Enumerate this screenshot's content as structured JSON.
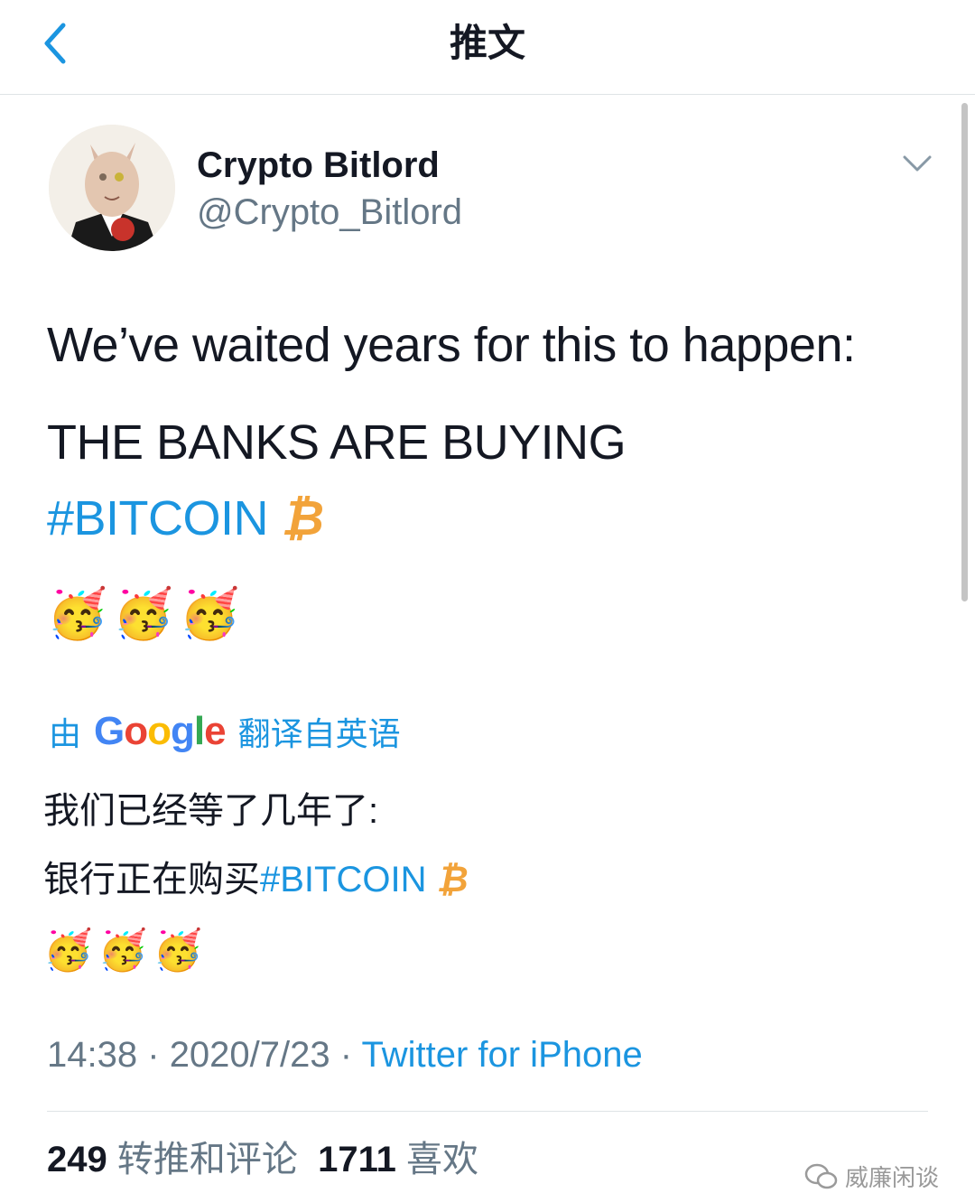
{
  "header": {
    "title": "推文"
  },
  "author": {
    "display_name": "Crypto Bitlord",
    "handle": "@Crypto_Bitlord"
  },
  "tweet": {
    "line1": "We’ve waited years for this to happen:",
    "line2": "THE BANKS ARE BUYING",
    "hashtag": "#BITCOIN",
    "btc_symbol": "₿",
    "emojis": [
      "🥳",
      "🥳",
      "🥳"
    ]
  },
  "translation": {
    "prefix": "由",
    "provider": "Google",
    "suffix": "翻译自英语",
    "line1": "我们已经等了几年了:",
    "line2_text": "银行正在购买",
    "line2_hashtag": "#BITCOIN",
    "btc_symbol": "₿",
    "emojis": [
      "🥳",
      "🥳",
      "🥳"
    ]
  },
  "meta": {
    "time": "14:38",
    "date": "2020/7/23",
    "sep": "·",
    "source": "Twitter for iPhone"
  },
  "stats": {
    "retweets_count": "249",
    "retweets_label": "转推和评论",
    "likes_count": "1711",
    "likes_label": "喜欢"
  },
  "watermark": {
    "text": "威廉闲谈"
  },
  "colors": {
    "link": "#1b95e0",
    "bitcoin": "#f2a33a",
    "secondary": "#657786"
  }
}
